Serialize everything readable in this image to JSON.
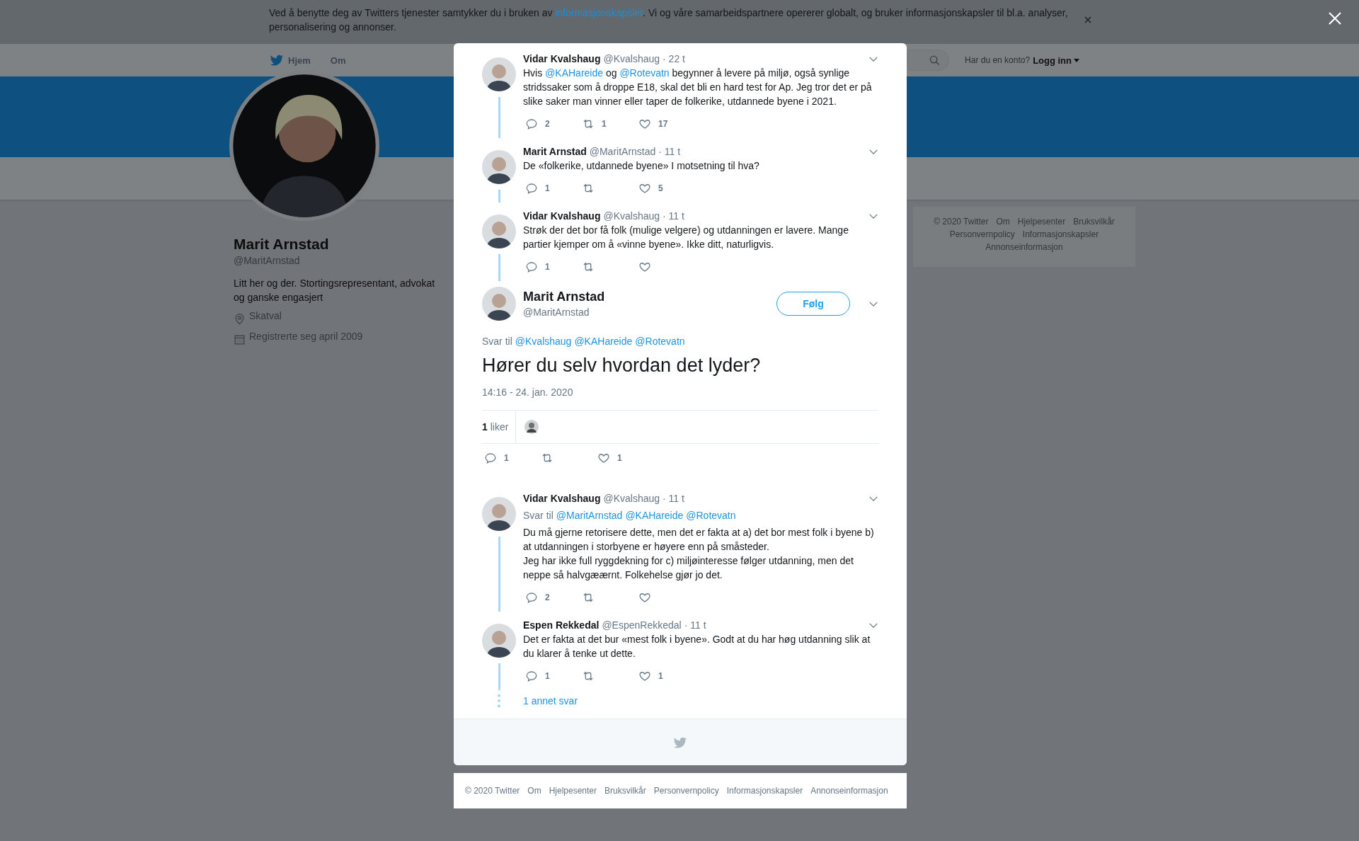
{
  "cookie_banner": {
    "text_before": "Ved å benytte deg av Twitters tjenester samtykker du i bruken av ",
    "link": "informasjonskapsler",
    "text_after": ". Vi og våre samarbeidspartnere opererer globalt, og bruker informasjonskapsler til bl.a. analyser, personalisering og annonser."
  },
  "header": {
    "nav": [
      {
        "label": "Hjem"
      },
      {
        "label": "Om"
      }
    ],
    "login_prompt": "Har du en konto?",
    "login": "Logg inn"
  },
  "profile": {
    "name": "Marit Arnstad",
    "handle": "@MaritArnstad",
    "bio": "Litt her og der. Stortingsrepresentant, advokat og ganske engasjert",
    "location": "Skatval",
    "joined": "Registrerte seg april 2009"
  },
  "side_footer": [
    "© 2020 Twitter",
    "Om",
    "Hjelpesenter",
    "Bruksvilkår",
    "Personvernpolicy",
    "Informasjonskapsler",
    "Annonseinformasjon"
  ],
  "thread": [
    {
      "kind": "reply",
      "name": "Vidar Kvalshaug",
      "handle": "@Kvalshaug",
      "time": "· 22 t",
      "text": [
        {
          "kind": "plain",
          "text": "Hvis "
        },
        {
          "kind": "mention",
          "text": "@KAHareide"
        },
        {
          "kind": "plain",
          "text": " og "
        },
        {
          "kind": "mention",
          "text": "@Rotevatn"
        },
        {
          "kind": "plain",
          "text": " begynner å levere på miljø, også synlige stridssaker som å droppe E18, skal det bli en hard test for Ap. Jeg tror det er på slike saker man vinner eller taper de folkerike, utdannede byene i 2021."
        }
      ],
      "replies": "2",
      "retweets": "1",
      "likes": "17",
      "thread_below": true
    },
    {
      "kind": "reply",
      "name": "Marit Arnstad",
      "handle": "@MaritArnstad",
      "time": "· 11 t",
      "text": [
        {
          "kind": "plain",
          "text": "De «folkerike, utdannede byene» I motsetning til hva?"
        }
      ],
      "replies": "1",
      "likes": "5",
      "thread_below": true
    },
    {
      "kind": "reply",
      "name": "Vidar Kvalshaug",
      "handle": "@Kvalshaug",
      "time": "· 11 t",
      "text": [
        {
          "kind": "plain",
          "text": "Strøk der det bor få folk (mulige velgere) og utdanningen er lavere. Mange partier kjemper om å «vinne byene». Ikke ditt, naturligvis."
        }
      ],
      "replies": "1",
      "thread_below": true
    },
    {
      "kind": "focus",
      "name": "Marit Arnstad",
      "handle": "@MaritArnstad",
      "follow": "Følg",
      "reply_to": {
        "label": "Svar til",
        "mentions": [
          "@Kvalshaug",
          "@KAHareide",
          "@Rotevatn"
        ]
      },
      "text": [
        {
          "kind": "plain",
          "text": "Hører du selv hvordan det lyder?"
        }
      ],
      "date": "14:16 - 24. jan. 2020",
      "like_summary": "**1** liker",
      "replies": "1",
      "likes": "1"
    },
    {
      "kind": "reply",
      "name": "Vidar Kvalshaug",
      "handle": "@Kvalshaug",
      "time": "· 11 t",
      "reply_to": {
        "label": "Svar til",
        "mentions": [
          "@MaritArnstad",
          "@KAHareide",
          "@Rotevatn"
        ]
      },
      "text": [
        {
          "kind": "plain",
          "text": "Du må gjerne retorisere dette, men det er fakta at a) det bor mest folk i byene b) at utdanningen i storbyene er høyere enn på småsteder.\nJeg har ikke full ryggdekning for c) miljøinteresse følger utdanning, men det neppe så halvgæærnt. Folkehelse gjør jo det."
        }
      ],
      "replies": "2",
      "thread_below": true
    },
    {
      "kind": "reply",
      "name": "Espen Rekkedal",
      "handle": "@EspenRekkedal",
      "time": "· 11 t",
      "text": [
        {
          "kind": "plain",
          "text": "Det er fakta at det bur «mest folk i byene». Godt at du har høg utdanning slik at du klarer å tenke ut dette."
        }
      ],
      "replies": "1",
      "likes": "1",
      "thread_below": true
    }
  ],
  "more_replies": "1 annet svar",
  "page_footer": [
    "© 2020 Twitter",
    "Om",
    "Hjelpesenter",
    "Bruksvilkår",
    "Personvernpolicy",
    "Informasjonskapsler",
    "Annonseinformasjon"
  ]
}
